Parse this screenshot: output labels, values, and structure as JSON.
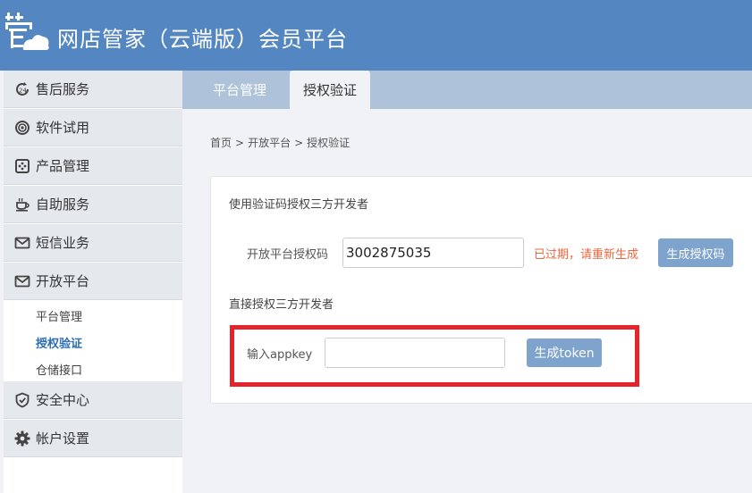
{
  "app": {
    "title": "网店管家（云端版）会员平台",
    "logo_icon": "housekeeper-cloud-logo",
    "header_color": "#5487c2"
  },
  "sidebar": {
    "items": [
      {
        "label": "售后服务",
        "icon": "clock-24-icon"
      },
      {
        "label": "软件试用",
        "icon": "target-icon"
      },
      {
        "label": "产品管理",
        "icon": "product-grid-icon"
      },
      {
        "label": "自助服务",
        "icon": "coffee-cup-icon"
      },
      {
        "label": "短信业务",
        "icon": "envelope-icon"
      },
      {
        "label": "开放平台",
        "icon": "envelope-icon"
      },
      {
        "label": "安全中心",
        "icon": "shield-icon"
      },
      {
        "label": "帐户设置",
        "icon": "gear-icon"
      }
    ],
    "subitems": [
      {
        "label": "平台管理",
        "active": false
      },
      {
        "label": "授权验证",
        "active": true
      },
      {
        "label": "仓储接口",
        "active": false
      }
    ]
  },
  "tabs": [
    {
      "label": "平台管理",
      "active": false
    },
    {
      "label": "授权验证",
      "active": true
    }
  ],
  "breadcrumb": {
    "home": "首页",
    "sep": ">",
    "section": "开放平台",
    "current": "授权验证"
  },
  "auth_code_section": {
    "title": "使用验证码授权三方开发者",
    "field_label": "开放平台授权码",
    "value": "3002875035",
    "status": "已过期，请重新生成",
    "status_color": "#e8683e",
    "button": "生成授权码"
  },
  "direct_section": {
    "title": "直接授权三方开发者",
    "field_label": "输入appkey",
    "value": "",
    "button": "生成token",
    "highlight_color": "#e5232a"
  },
  "colors": {
    "button": "#7ea3cc",
    "active_link": "#2d6db5"
  }
}
